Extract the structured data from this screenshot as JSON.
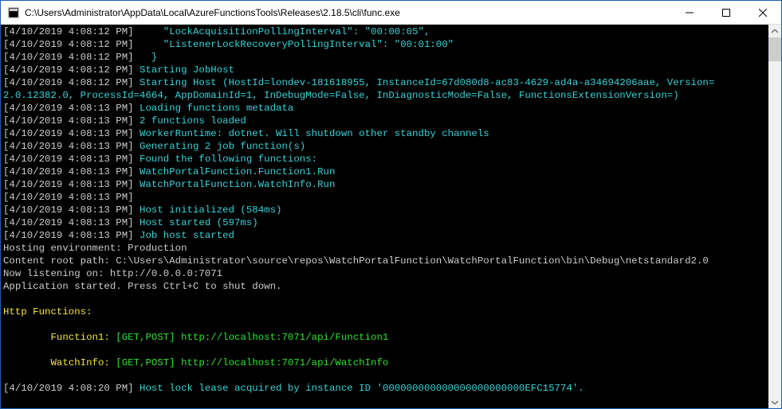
{
  "titlebar": {
    "title": "C:\\Users\\Administrator\\AppData\\Local\\AzureFunctionsTools\\Releases\\2.18.5\\cli\\func.exe"
  },
  "l": {
    "t1": "[4/10/2019 4:08:12 PM] ",
    "c1": "    \"LockAcquisitionPollingInterval\": \"00:00:05\",",
    "t2": "[4/10/2019 4:08:12 PM] ",
    "c2": "    \"ListenerLockRecoveryPollingInterval\": \"00:01:00\"",
    "t3": "[4/10/2019 4:08:12 PM] ",
    "c3": "  }",
    "t4": "[4/10/2019 4:08:12 PM] ",
    "c4": "Starting JobHost",
    "t5": "[4/10/2019 4:08:12 PM] ",
    "c5a": "Starting Host (HostId=londev-181618955, InstanceId=67d080d8-ac83-4629-ad4a-a34694206aae, Version=",
    "c5b": "2.0.12382.0, ProcessId=4664, AppDomainId=1, InDebugMode=False, InDiagnosticMode=False, FunctionsExtensionVersion=)",
    "t6": "[4/10/2019 4:08:13 PM] ",
    "c6": "Loading functions metadata",
    "t7": "[4/10/2019 4:08:13 PM] ",
    "c7": "2 functions loaded",
    "t8": "[4/10/2019 4:08:13 PM] ",
    "c8": "WorkerRuntime: dotnet. Will shutdown other standby channels",
    "t9": "[4/10/2019 4:08:13 PM] ",
    "c9": "Generating 2 job function(s)",
    "t10": "[4/10/2019 4:08:13 PM] ",
    "c10": "Found the following functions:",
    "t11": "[4/10/2019 4:08:13 PM] ",
    "c11": "WatchPortalFunction.Function1.Run",
    "t12": "[4/10/2019 4:08:13 PM] ",
    "c12": "WatchPortalFunction.WatchInfo.Run",
    "t13": "[4/10/2019 4:08:13 PM] ",
    "t14": "[4/10/2019 4:08:13 PM] ",
    "c14": "Host initialized (584ms)",
    "t15": "[4/10/2019 4:08:13 PM] ",
    "c15": "Host started (597ms)",
    "t16": "[4/10/2019 4:08:13 PM] ",
    "c16": "Job host started",
    "g1": "Hosting environment: Production",
    "g2": "Content root path: C:\\Users\\Administrator\\source\\repos\\WatchPortalFunction\\WatchPortalFunction\\bin\\Debug\\netstandard2.0",
    "g3": "Now listening on: http://0.0.0.0:7071",
    "g4": "Application started. Press Ctrl+C to shut down.",
    "hf": "Http Functions:",
    "f1pad": "        ",
    "f1name": "Function1:",
    "f1rest": " [GET,POST] http://localhost:7071/api/Function1",
    "f2pad": "        ",
    "f2name": "WatchInfo:",
    "f2rest": " [GET,POST] http://localhost:7071/api/WatchInfo",
    "t17": "[4/10/2019 4:08:20 PM] ",
    "c17": "Host lock lease acquired by instance ID '000000000000000000000000EFC15774'."
  }
}
